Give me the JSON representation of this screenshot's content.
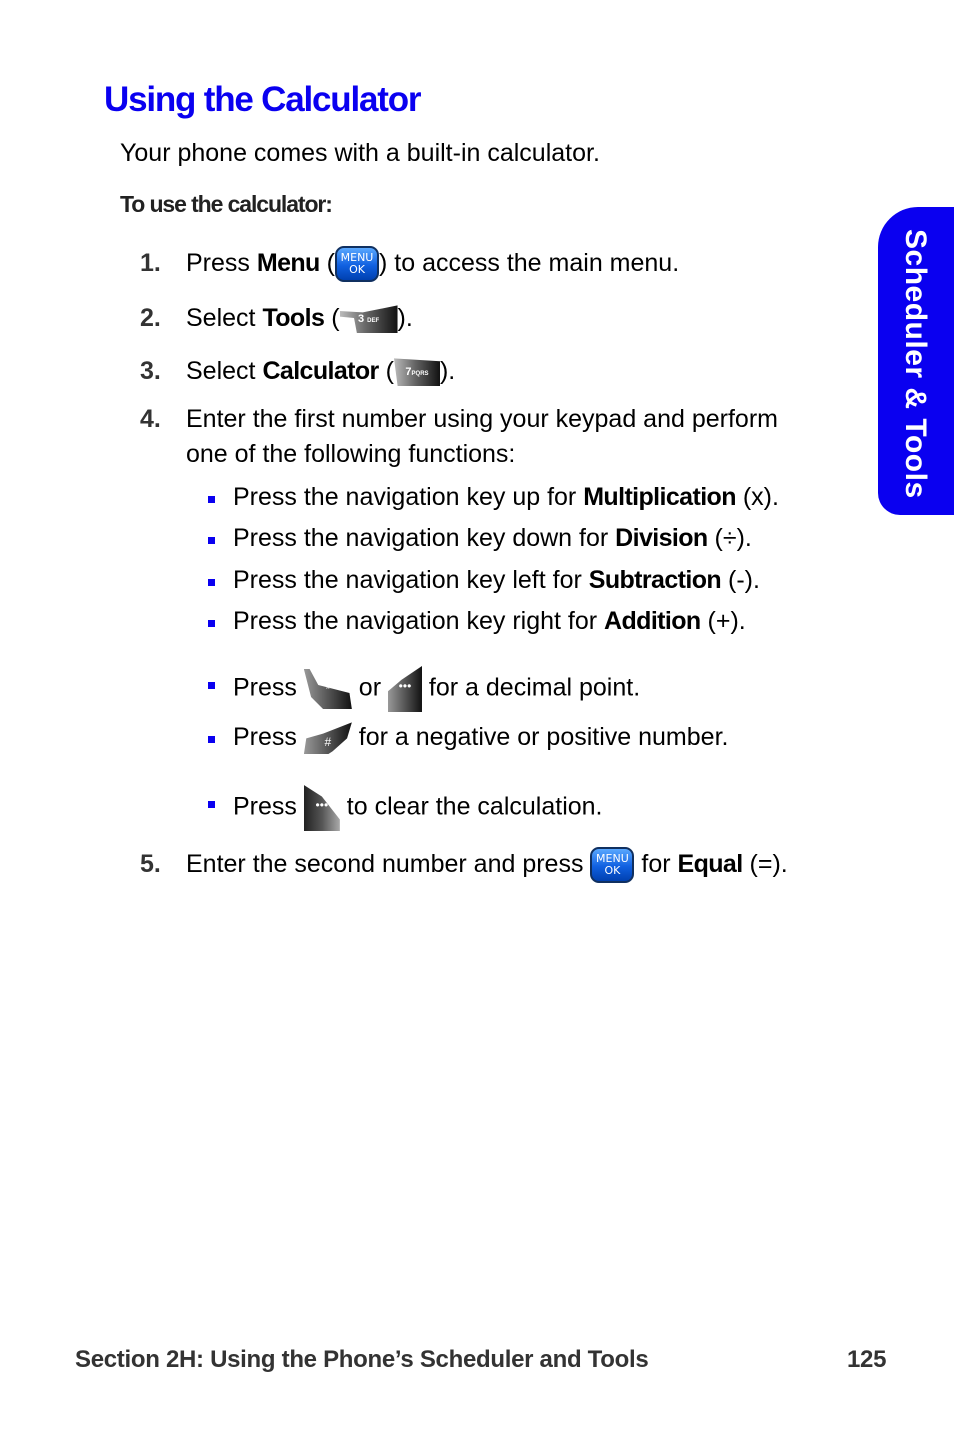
{
  "page": {
    "title": "Using the Calculator",
    "intro": "Your phone comes with a built-in calculator.",
    "subhead": "To use the calculator:",
    "side_tab": "Scheduler & Tools",
    "steps": [
      {
        "num": "1.",
        "pre": "Press ",
        "bold": "Menu",
        "mid": " (",
        "key": "MENU/OK",
        "post": ") to access the main menu."
      },
      {
        "num": "2.",
        "pre": "Select ",
        "bold": "Tools",
        "mid": " (",
        "key": "3 DEF",
        "post": ")."
      },
      {
        "num": "3.",
        "pre": "Select ",
        "bold": "Calculator",
        "mid": " (",
        "key": "7 PQRS",
        "post": ")."
      },
      {
        "num": "4.",
        "line1": "Enter the first number using your keypad and perform",
        "line2": "one of the following functions:"
      },
      {
        "num": "5.",
        "pre": "Enter the second number and press ",
        "key": "MENU/OK",
        "mid": " for ",
        "bold": "Equal",
        "post": " (=)."
      }
    ],
    "bullets": [
      {
        "pre": "Press the navigation key up for ",
        "bold": "Multiplication",
        "post": " (x)."
      },
      {
        "pre": "Press the navigation key down for ",
        "bold": "Division",
        "post": " (÷)."
      },
      {
        "pre": "Press the navigation key left for ",
        "bold": "Subtraction",
        "post": " (-)."
      },
      {
        "pre": "Press the navigation key right for ",
        "bold": "Addition",
        "post": " (+)."
      },
      {
        "pre": "Press ",
        "mid": " or ",
        "post": " for a decimal point.",
        "key1": "*Shift",
        "key2": "•••"
      },
      {
        "pre": "Press ",
        "post": " for a negative or positive number.",
        "key1": "#Space"
      },
      {
        "pre": "Press ",
        "post": " to clear the calculation.",
        "key1": "•••"
      }
    ],
    "keys": {
      "menu_top": "MENU",
      "menu_bottom": "OK",
      "k3": "3",
      "k3_sub": "DEF",
      "k7": "7",
      "k7_sub": "PQRS",
      "star": "*",
      "hash": "#",
      "dots": "•••"
    },
    "footer": {
      "section": "Section 2H: Using the Phone’s Scheduler and Tools",
      "page_number": "125"
    }
  }
}
